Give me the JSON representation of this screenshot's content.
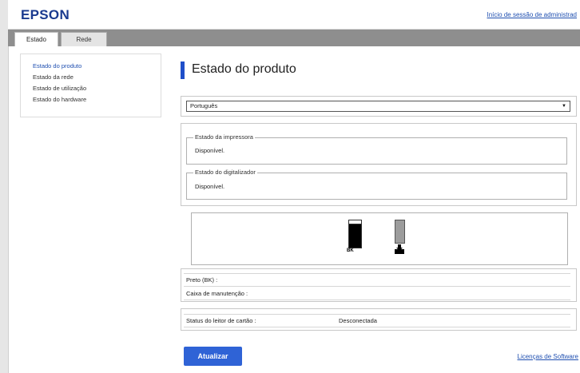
{
  "header": {
    "logo": "EPSON",
    "admin_link": "Início de sessão de administrad"
  },
  "tabs": [
    {
      "label": "Estado",
      "active": true
    },
    {
      "label": "Rede",
      "active": false
    }
  ],
  "sidebar": {
    "items": [
      {
        "label": "Estado do produto",
        "active": true
      },
      {
        "label": "Estado da rede",
        "active": false
      },
      {
        "label": "Estado de utilização",
        "active": false
      },
      {
        "label": "Estado do hardware",
        "active": false
      }
    ]
  },
  "main": {
    "title": "Estado do produto",
    "language": {
      "selected": "Português"
    },
    "printer_status": {
      "legend": "Estado da impressora",
      "value": "Disponível."
    },
    "scanner_status": {
      "legend": "Estado do digitalizador",
      "value": "Disponível."
    },
    "ink": {
      "black_label": "BK"
    },
    "rows": {
      "black": "Preto (BK) :",
      "maintenance": "Caixa de manutenção :"
    },
    "card_reader": {
      "label": "Status do leitor de cartão :",
      "value": "Desconectada"
    },
    "update_button": "Atualizar",
    "license_link": "Licenças de Software"
  },
  "colors": {
    "accent": "#1f4fc9",
    "button": "#2f63d6",
    "link": "#1f4fb0",
    "tabbar": "#8e8e8e"
  },
  "icons": [
    "dropdown-arrow-icon",
    "ink-cartridge-icon",
    "maintenance-box-icon"
  ]
}
